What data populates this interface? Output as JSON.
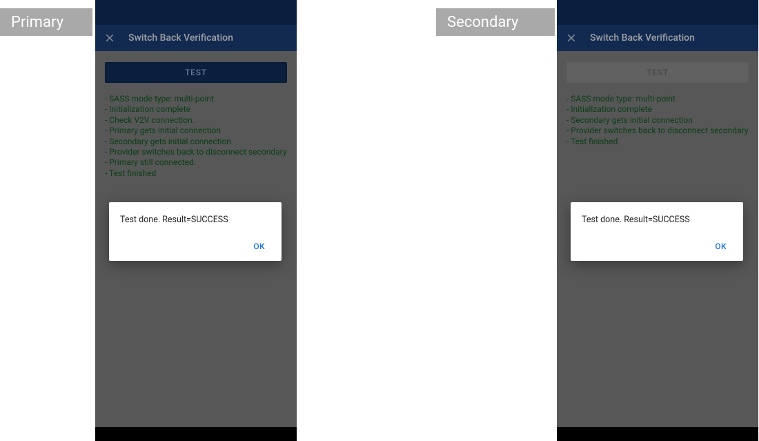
{
  "tags": {
    "primary": "Primary",
    "secondary": "Secondary"
  },
  "header": {
    "title": "Switch Back Verification"
  },
  "test_button": {
    "label": "TEST"
  },
  "dialog": {
    "message": "Test done. Result=SUCCESS",
    "ok": "OK"
  },
  "left_log": [
    "- SASS mode type: multi-point",
    "- Initialization complete",
    "- Check V2V connection.",
    "- Primary gets initial connection",
    "- Secondary gets initial connection",
    "- Provider switches back to disconnect secondary",
    "- Primary still connected.",
    "- Test finished"
  ],
  "right_log": [
    "- SASS mode type: multi-point",
    "- Initialization complete",
    "- Secondary gets initial connection",
    "- Provider switches back to disconnect secondary",
    "- Test finished"
  ]
}
